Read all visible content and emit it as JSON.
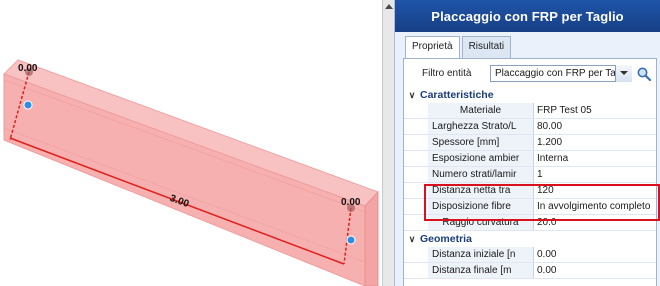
{
  "viewport": {
    "labels": {
      "left_top": "0.00",
      "right_top": "0.00",
      "length": "3.00"
    },
    "colors": {
      "beam_fill": "#f7b5b5",
      "beam_edge": "#ee9a9a",
      "dimension": "#e0201d",
      "marker": "#2a8ee6"
    }
  },
  "panel": {
    "title": "Placcaggio con FRP per Taglio",
    "tabs": [
      {
        "label": "Proprietà",
        "active": true
      },
      {
        "label": "Risultati",
        "active": false
      }
    ],
    "filter": {
      "label": "Filtro entità",
      "value": "Placcaggio con FRP per Tagl",
      "search_icon": "magnifier-icon"
    },
    "sections": [
      {
        "title": "Caratteristiche",
        "rows": [
          {
            "name": "Materiale",
            "value": "FRP Test 05",
            "center": true
          },
          {
            "name": "Larghezza Strato/L",
            "value": "80.00"
          },
          {
            "name": "Spessore  [mm]",
            "value": "1.200"
          },
          {
            "name": "Esposizione ambier",
            "value": "Interna"
          },
          {
            "name": "Numero strati/lamir",
            "value": "1"
          },
          {
            "name": "Distanza netta tra",
            "value": "120"
          },
          {
            "name": "Disposizione fibre",
            "value": "In avvolgimento completo"
          },
          {
            "name": "Raggio curvatura",
            "value": "20.0",
            "center": true
          }
        ]
      },
      {
        "title": "Geometria",
        "rows": [
          {
            "name": "Distanza iniziale  [n",
            "value": "0.00"
          },
          {
            "name": "Distanza finale  [m",
            "value": "0.00"
          }
        ]
      }
    ],
    "highlight_color": "#d9111c"
  }
}
